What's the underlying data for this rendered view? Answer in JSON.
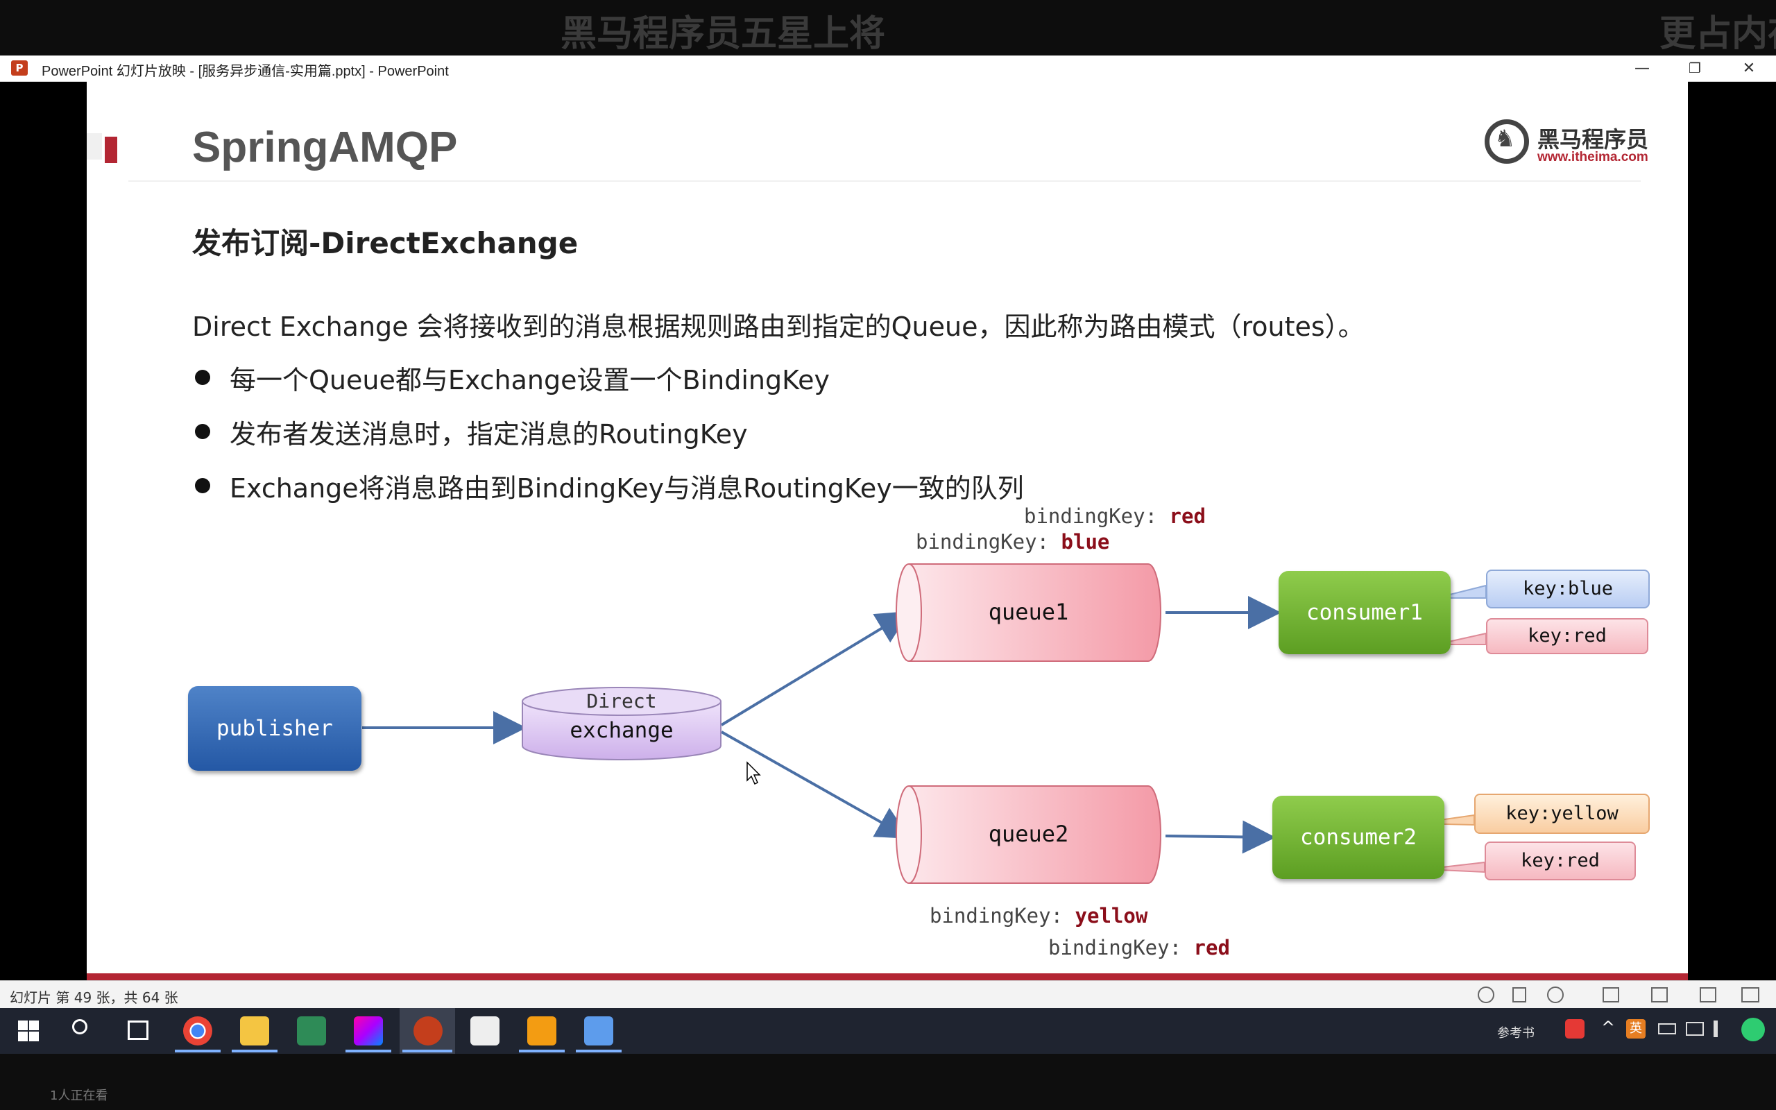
{
  "overlay": {
    "left_text": "黑马程序员五星上将",
    "right_text": "更占内存"
  },
  "window": {
    "title": "PowerPoint 幻灯片放映 - [服务异步通信-实用篇.pptx] - PowerPoint",
    "minimize": "—",
    "restore": "❐",
    "close": "✕"
  },
  "slide": {
    "title": "SpringAMQP",
    "brand_name": "黑马程序员",
    "brand_url": "www.itheima.com",
    "subtitle": "发布订阅-DirectExchange",
    "intro": "Direct Exchange 会将接收到的消息根据规则路由到指定的Queue，因此称为路由模式（routes）。",
    "bullets": [
      "每一个Queue都与Exchange设置一个BindingKey",
      "发布者发送消息时，指定消息的RoutingKey",
      "Exchange将消息路由到BindingKey与消息RoutingKey一致的队列"
    ],
    "diagram": {
      "publisher": "publisher",
      "exchange_type": "Direct",
      "exchange": "exchange",
      "queue1": "queue1",
      "queue2": "queue2",
      "consumer1": "consumer1",
      "consumer2": "consumer2",
      "binding_prefix": "bindingKey:",
      "q1_bindings": [
        "red",
        "blue"
      ],
      "q2_bindings": [
        "yellow",
        "red"
      ],
      "c1_keys": [
        "key:blue",
        "key:red"
      ],
      "c2_keys": [
        "key:yellow",
        "key:red"
      ]
    }
  },
  "status": {
    "slide_info": "幻灯片 第 49 张，共 64 张"
  },
  "taskbar": {
    "tray_label": "参考书",
    "ime": "英"
  },
  "viewers": "1人正在看",
  "colors": {
    "accent_red": "#b32633",
    "publisher_blue": "#2458a5",
    "consumer_green": "#5c9e22",
    "queue_pink": "#f5a3ae",
    "exchange_purple": "#d8c2f0",
    "arrow": "#4a6fa5"
  }
}
